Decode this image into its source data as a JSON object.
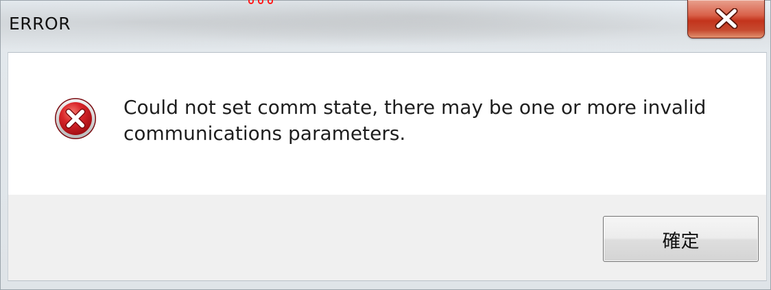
{
  "window": {
    "title": "ERROR"
  },
  "dialog": {
    "message": "Could not set comm state, there may be one or more invalid communications parameters.",
    "icon": "error-icon",
    "ok_label": "確定"
  },
  "colors": {
    "close_button": "#c3341c",
    "error_icon": "#c8141b",
    "content_background": "#ffffff",
    "button_bar_background": "#f0f0f0"
  }
}
